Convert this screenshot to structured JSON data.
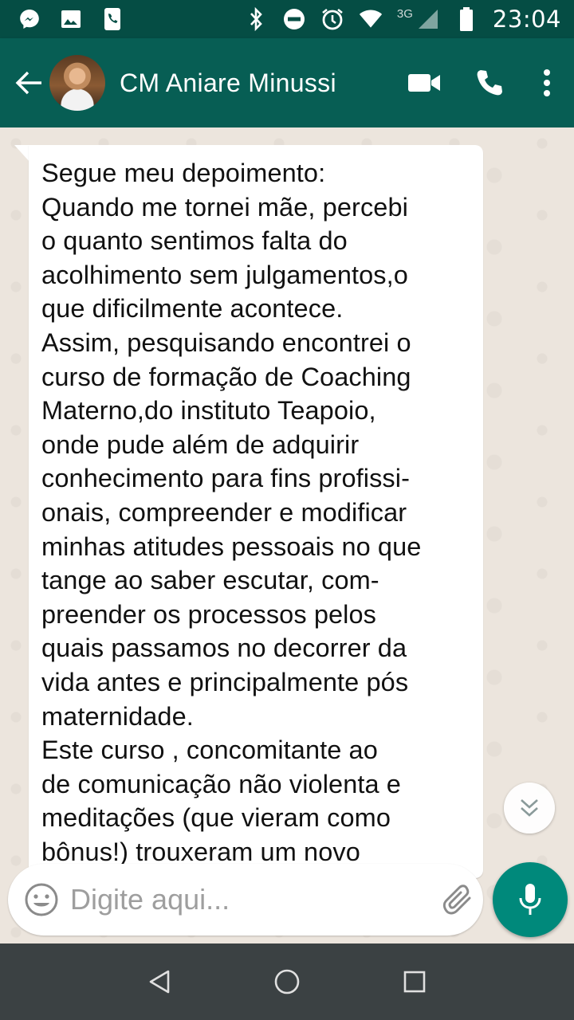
{
  "status_bar": {
    "network_type": "3G",
    "time": "23:04",
    "left_icons": [
      "messenger-icon",
      "image-icon",
      "phone-notification-icon"
    ],
    "right_icons": [
      "bluetooth-icon",
      "do-not-disturb-icon",
      "alarm-icon",
      "wifi-icon",
      "cell-signal-icon",
      "battery-icon"
    ]
  },
  "header": {
    "contact_name": "CM Aniare Minussi",
    "actions": [
      "video-call-icon",
      "voice-call-icon",
      "more-options-icon"
    ]
  },
  "message": {
    "lines": [
      "Segue meu depoimento:",
      "Quando me tornei mãe, percebi",
      "o quanto sentimos falta do",
      "acolhimento sem julgamentos,o",
      "que dificilmente acontece.",
      "Assim, pesquisando encontrei o",
      "curso de formação de Coaching",
      "Materno,do instituto Teapoio,",
      "onde pude além de adquirir",
      "conhecimento para fins profissi-",
      "onais, compreender e modificar",
      "minhas atitudes pessoais no que",
      "tange ao saber escutar, com-",
      "preender os processos pelos",
      "quais passamos no decorrer da",
      "vida antes e principalmente pós",
      "maternidade.",
      "Este curso , concomitante ao",
      "de comunicação não violenta e",
      "meditações (que vieram como",
      "bônus!) trouxeram um novo"
    ]
  },
  "compose": {
    "placeholder": "Digite aqui...",
    "value": ""
  },
  "colors": {
    "status_bar": "#054D44",
    "app_bar": "#075E54",
    "chat_background": "#ECE5DD",
    "mic_button": "#00897B",
    "nav_bar": "#3B4143"
  }
}
